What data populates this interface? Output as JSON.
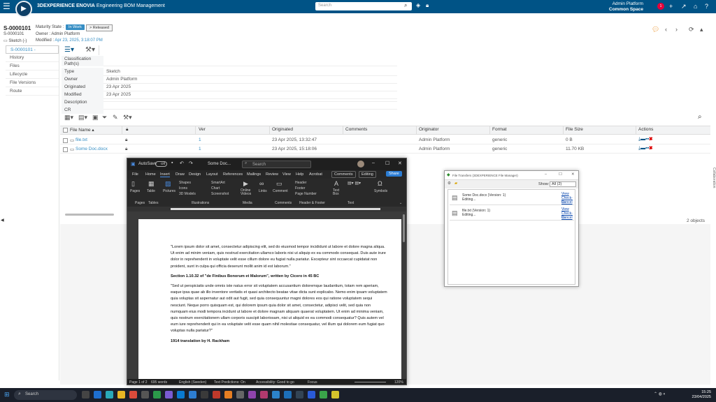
{
  "app": {
    "brand": "3DEXPERIENCE ENOVIA",
    "title": "Engineering BOM Management",
    "search_placeholder": "Search",
    "user_name": "Admin Platform",
    "user_space": "Common Space",
    "badge_count": "1"
  },
  "header": {
    "object_id": "S-0000101",
    "object_sub": "S-0000101",
    "object_type": "Sketch (-)",
    "maturity_label": "Maturity State :",
    "state_in_work": "In Work",
    "state_released": "> Released",
    "owner": "Owner : Admin Platform",
    "modified_label": "Modified :",
    "modified_value": "Apr 23, 2025, 3:18:07 PM"
  },
  "nav": {
    "current": "S-0000101 -",
    "items": [
      "History",
      "Files",
      "Lifecycle",
      "File Versions",
      "Route"
    ]
  },
  "properties": [
    {
      "label": "Classification Path(s)",
      "value": ""
    },
    {
      "label": "Type",
      "value": "Sketch"
    },
    {
      "label": "Owner",
      "value": "Admin Platform"
    },
    {
      "label": "Originated",
      "value": "23 Apr 2025"
    },
    {
      "label": "Modified",
      "value": "23 Apr 2025"
    },
    {
      "label": "Description",
      "value": ""
    },
    {
      "label": "CR",
      "value": ""
    }
  ],
  "table": {
    "headers": {
      "file_name": "File Name",
      "ver": "Ver",
      "originated": "Originated",
      "comments": "Comments",
      "originator": "Originator",
      "format": "Format",
      "file_size": "File Size",
      "actions": "Actions"
    },
    "rows": [
      {
        "file_name": "file.txt",
        "ver": "1",
        "originated": "23 Apr 2025, 13:32:47",
        "comments": "",
        "originator": "Admin Platform",
        "format": "generic",
        "file_size": "0 B"
      },
      {
        "file_name": "Some Doc.docx",
        "ver": "1",
        "originated": "23 Apr 2025, 15:18:06",
        "comments": "",
        "originator": "Admin Platform",
        "format": "generic",
        "file_size": "11.70 KB"
      }
    ],
    "count": "2 objects"
  },
  "word": {
    "autosave": "AutoSave",
    "autosave_state": "Off",
    "doc_title": "Some Doc...",
    "search_placeholder": "Search",
    "menus": [
      "File",
      "Home",
      "Insert",
      "Draw",
      "Design",
      "Layout",
      "References",
      "Mailings",
      "Review",
      "View",
      "Help",
      "Acrobat"
    ],
    "comments_btn": "Comments",
    "editing_btn": "Editing",
    "share_btn": "Share",
    "ribbon_groups": [
      "Pages",
      "Tables",
      "Illustrations",
      "Media",
      "Links",
      "Comments",
      "Header & Footer",
      "Text",
      "Symbols"
    ],
    "ribbon_items": [
      "Pages",
      "Table",
      "Pictures",
      "Shapes",
      "Icons",
      "3D Models",
      "SmartArt",
      "Chart",
      "Screenshot",
      "Online Videos",
      "Links",
      "Comment",
      "Header",
      "Footer",
      "Page Number",
      "Text Box",
      "Symbols"
    ],
    "p1": "\"Lorem ipsum dolor sit amet, consectetur adipiscing elit, sed do eiusmod tempor incididunt ut labore et dolore magna aliqua. Ut enim ad minim veniam, quis nostrud exercitation ullamco laboris nisi ut aliquip ex ea commodo consequat. Duis aute irure dolor in reprehenderit in voluptate velit esse cillum dolore eu fugiat nulla pariatur. Excepteur sint occaecat cupidatat non proident, sunt in culpa qui officia deserunt mollit anim id est laborum.\"",
    "h1": "Section 1.10.32 of \"de Finibus Bonorum et Malorum\", written by Cicero in 45 BC",
    "p2": "\"Sed ut perspiciatis unde omnis iste natus error sit voluptatem accusantium doloremque laudantium, totam rem aperiam, eaque ipsa quae ab illo inventore veritatis et quasi architecto beatae vitae dicta sunt explicabo. Nemo enim ipsam voluptatem quia voluptas sit aspernatur aut odit aut fugit, sed quia consequuntur magni dolores eos qui ratione voluptatem sequi nesciunt. Neque porro quisquam est, qui dolorem ipsum quia dolor sit amet, consectetur, adipisci velit, sed quia non numquam eius modi tempora incidunt ut labore et dolore magnam aliquam quaerat voluptatem. Ut enim ad minima veniam, quis nostrum exercitationem ullam corporis suscipit laboriosam, nisi ut aliquid ex ea commodi consequatur? Quis autem vel eum iure reprehenderit qui in ea voluptate velit esse quam nihil molestiae consequatur, vel illum qui dolorem eum fugiat quo voluptas nulla pariatur?\"",
    "h2": "1914 translation by H. Rackham",
    "status": {
      "page": "Page 1 of 2",
      "words": "695 words",
      "lang": "English (Sweden)",
      "predictions": "Text Predictions: On",
      "accessibility": "Accessibility: Good to go",
      "focus": "Focus",
      "zoom": "120%"
    }
  },
  "file_transfers": {
    "title": "File Transfers (3DEXPERIENCE File Manager)",
    "show_label": "Show:",
    "show_value": "All (2)",
    "items": [
      {
        "name": "Some Doc.docx (Version: 1)",
        "status": "Editing...",
        "view": "View",
        "checkin": "Check-In",
        "cancel": "Cancel"
      },
      {
        "name": "file.txt (Version: 1)",
        "status": "Editing...",
        "view": "View",
        "checkin": "Check-In",
        "cancel": "Cancel"
      }
    ]
  },
  "right_panel": "Collaboration",
  "taskbar": {
    "search": "Search",
    "time": "15:25",
    "date": "23/04/2025"
  },
  "colors": {
    "topbar": "#005386",
    "accent": "#368ec4",
    "word_dark": "#1f1f1f",
    "share": "#2b7cd3"
  }
}
